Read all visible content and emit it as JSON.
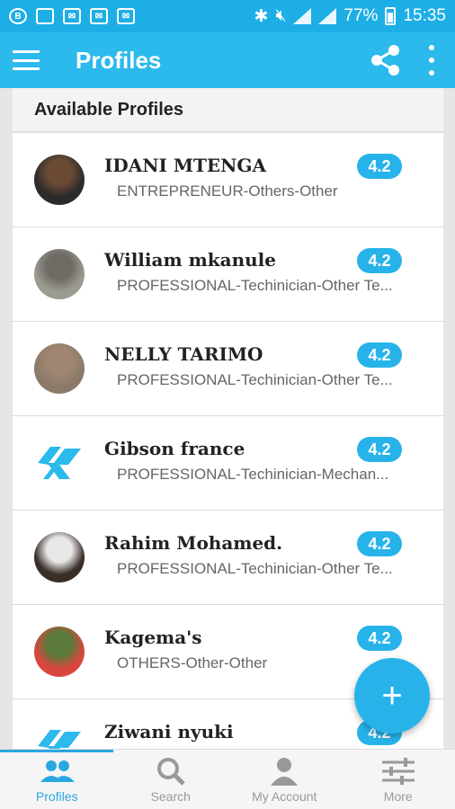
{
  "status_bar": {
    "battery": "77%",
    "time": "15:35"
  },
  "app_bar": {
    "title": "Profiles"
  },
  "list": {
    "header": "Available Profiles",
    "items": [
      {
        "name": "IDANI MTENGA",
        "subtitle": "ENTREPRENEUR-Others-Other",
        "rating": "4.2",
        "avatar": "photo"
      },
      {
        "name": "William mkanule",
        "subtitle": "PROFESSIONAL-Techinician-Other Te...",
        "rating": "4.2",
        "avatar": "photo"
      },
      {
        "name": "NELLY TARIMO",
        "subtitle": "PROFESSIONAL-Techinician-Other Te...",
        "rating": "4.2",
        "avatar": "photo"
      },
      {
        "name": "Gibson france",
        "subtitle": "PROFESSIONAL-Techinician-Mechan...",
        "rating": "4.2",
        "avatar": "logo"
      },
      {
        "name": "Rahim Mohamed.",
        "subtitle": "PROFESSIONAL-Techinician-Other Te...",
        "rating": "4.2",
        "avatar": "photo"
      },
      {
        "name": "Kagema's",
        "subtitle": "OTHERS-Other-Other",
        "rating": "4.2",
        "avatar": "photo"
      },
      {
        "name": "Ziwani nyuki",
        "subtitle": "",
        "rating": "4.2",
        "avatar": "logo"
      }
    ]
  },
  "fab": {
    "label": "+"
  },
  "bottom_nav": {
    "tabs": [
      {
        "label": "Profiles",
        "icon": "people-icon",
        "active": true
      },
      {
        "label": "Search",
        "icon": "search-icon",
        "active": false
      },
      {
        "label": "My Account",
        "icon": "person-icon",
        "active": false
      },
      {
        "label": "More",
        "icon": "sliders-icon",
        "active": false
      }
    ]
  },
  "colors": {
    "primary": "#2cb9ec",
    "status_bar": "#1daee6",
    "accent": "#27b3ea"
  }
}
